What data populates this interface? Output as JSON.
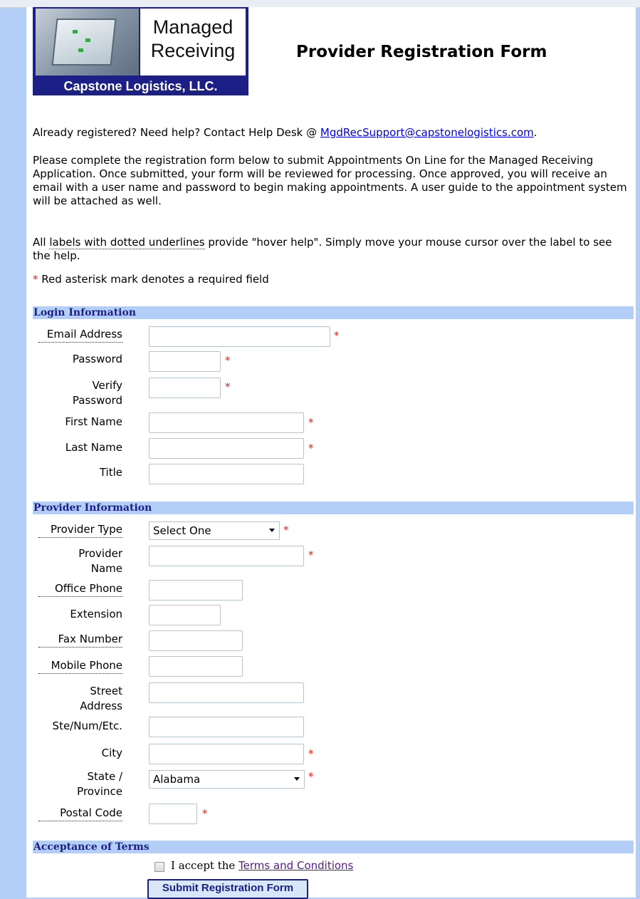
{
  "header": {
    "logo_line1": "Managed",
    "logo_line2": "Receiving",
    "logo_company": "Capstone Logistics, LLC.",
    "title": "Provider Registration Form"
  },
  "intro": {
    "help_prefix": "Already registered? Need help? Contact Help Desk @ ",
    "help_email": "MgdRecSupport@capstonelogistics.com",
    "help_suffix": ".",
    "instructions": "Please complete the registration form below to submit Appointments On Line for the Managed Receiving Application. Once submitted, your form will be reviewed for processing. Once approved, you will receive an email with a user name and password to begin making appointments. A user guide to the appointment system will be attached as well.",
    "hover_pre": "All ",
    "hover_link": "labels with dotted underlines",
    "hover_post": " provide \"hover help\". Simply move your mouse cursor over the label to see the help.",
    "required_mark": "*",
    "required_note": " Red asterisk mark denotes a required field"
  },
  "login": {
    "section_title": "Login Information",
    "email_label": "Email Address",
    "email_value": "",
    "password_label": "Password",
    "password_value": "",
    "verify_label_1": "Verify",
    "verify_label_2": "Password",
    "verify_value": "",
    "first_label": "First Name",
    "first_value": "",
    "last_label": "Last Name",
    "last_value": "",
    "title_label": "Title",
    "title_value": ""
  },
  "provider": {
    "section_title": "Provider Information",
    "type_label": "Provider Type",
    "type_selected": "Select One",
    "name_label_1": "Provider",
    "name_label_2": "Name",
    "name_value": "",
    "office_label": "Office Phone",
    "office_value": "",
    "ext_label": "Extension",
    "ext_value": "",
    "fax_label": "Fax Number",
    "fax_value": "",
    "mobile_label": "Mobile Phone",
    "mobile_value": "",
    "street_label_1": "Street",
    "street_label_2": "Address",
    "street_value": "",
    "ste_label": "Ste/Num/Etc.",
    "ste_value": "",
    "city_label": "City",
    "city_value": "",
    "state_label_1": "State /",
    "state_label_2": "Province",
    "state_selected": "Alabama",
    "postal_label": "Postal Code",
    "postal_value": ""
  },
  "terms": {
    "section_title": "Acceptance of Terms",
    "accept_pre": "I accept the ",
    "accept_link": "Terms and Conditions",
    "checked": false
  },
  "submit_label": "Submit Registration Form",
  "colors": {
    "page_bg": "#b4cff7",
    "section_text": "#1b1f86",
    "required": "#e02020",
    "link": "#0000ee",
    "visited_link": "#551a8b"
  }
}
